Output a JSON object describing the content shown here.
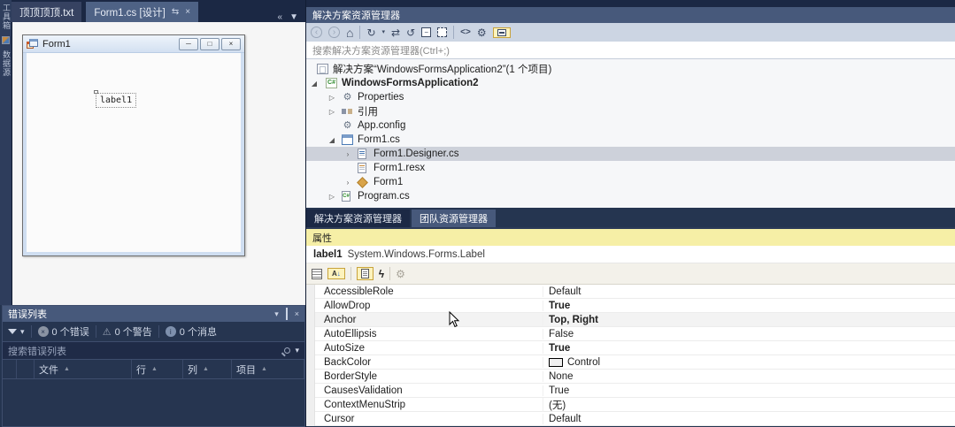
{
  "colors": {
    "chrome_bg": "#253550",
    "panel_title_bg": "#47597b",
    "active_doc_tab": "#4e6285",
    "focused_panel_title": "#f6efa6",
    "toolbar_light": "#ccd5e3",
    "inactive_selection": "#cdd1da",
    "toggle_active_bg": "#fdf3bd",
    "toggle_active_border": "#c8a33b",
    "backcolor_swatch": "#f0f0f0"
  },
  "left_dock": {
    "tabs": [
      {
        "label": "工具箱"
      },
      {
        "label": "数据源"
      }
    ]
  },
  "doc_tabs": {
    "tabs": [
      {
        "label": "顶顶顶顶.txt"
      },
      {
        "label": "Form1.cs [设计]"
      }
    ],
    "promote_glyph": "⇆",
    "close_glyph": "×",
    "overflow_glyph": "«",
    "menu_glyph": "▼"
  },
  "designer": {
    "form_title": "Form1",
    "minimize_glyph": "─",
    "maximize_glyph": "□",
    "close_glyph": "×",
    "label_text": "label1"
  },
  "error_list": {
    "title": "错误列表",
    "menu_glyph": "▾",
    "close_glyph": "×",
    "filter_dropdown_glyph": "▾",
    "error_icon_glyph": "×",
    "info_icon_glyph": "i",
    "warning_icon_glyph": "⚠",
    "error_count": "0 个错误",
    "warning_count": "0 个警告",
    "message_count": "0 个消息",
    "search_placeholder": "搜索错误列表",
    "search_dropdown_glyph": "▾",
    "sort_glyph": "▲",
    "columns": [
      {
        "label": "文件"
      },
      {
        "label": "行"
      },
      {
        "label": "列"
      },
      {
        "label": "项目"
      }
    ]
  },
  "solution_explorer": {
    "title": "解决方案资源管理器",
    "toolbar_glyphs": {
      "back": "‹",
      "forward": "›",
      "home": "⌂",
      "pending": "↻",
      "dropdown": "▾",
      "sync": "⇄",
      "refresh": "↺",
      "collapse_all": "−",
      "code_view": "<>",
      "properties": "⚙"
    },
    "search_placeholder": "搜索解决方案资源管理器(Ctrl+;)",
    "tree": [
      {
        "expander": "",
        "icon": "solution-icon",
        "label": "解决方案“WindowsFormsApplication2”(1 个项目)"
      },
      {
        "expander": "◢",
        "icon": "csharp-project-icon",
        "label": "WindowsFormsApplication2"
      },
      {
        "expander": "▷",
        "icon": "properties-gear-icon",
        "label": "Properties"
      },
      {
        "expander": "▷",
        "icon": "references-icon",
        "label": "引用"
      },
      {
        "expander": "",
        "icon": "config-gear-icon",
        "label": "App.config"
      },
      {
        "expander": "◢",
        "icon": "form-icon",
        "label": "Form1.cs"
      },
      {
        "expander": "›",
        "icon": "code-file-icon",
        "label": "Form1.Designer.cs"
      },
      {
        "expander": "",
        "icon": "resx-file-icon",
        "label": "Form1.resx"
      },
      {
        "expander": "›",
        "icon": "class-icon",
        "label": "Form1"
      },
      {
        "expander": "▷",
        "icon": "csharp-file-icon",
        "label": "Program.cs"
      }
    ],
    "tabs": [
      {
        "label": "解决方案资源管理器"
      },
      {
        "label": "团队资源管理器"
      }
    ]
  },
  "properties_panel": {
    "title": "属性",
    "object_name": "label1",
    "object_type": "System.Windows.Forms.Label",
    "az_glyph": "A",
    "az_arrow_glyph": "↓",
    "events_glyph": "ϟ",
    "wrench_glyph": "⚙",
    "rows": [
      {
        "name": "AccessibleRole",
        "value": "Default"
      },
      {
        "name": "AllowDrop",
        "value": "True"
      },
      {
        "name": "Anchor",
        "value": "Top, Right"
      },
      {
        "name": "AutoEllipsis",
        "value": "False"
      },
      {
        "name": "AutoSize",
        "value": "True"
      },
      {
        "name": "BackColor",
        "value": "Control"
      },
      {
        "name": "BorderStyle",
        "value": "None"
      },
      {
        "name": "CausesValidation",
        "value": "True"
      },
      {
        "name": "ContextMenuStrip",
        "value": "(无)"
      },
      {
        "name": "Cursor",
        "value": "Default"
      }
    ]
  }
}
